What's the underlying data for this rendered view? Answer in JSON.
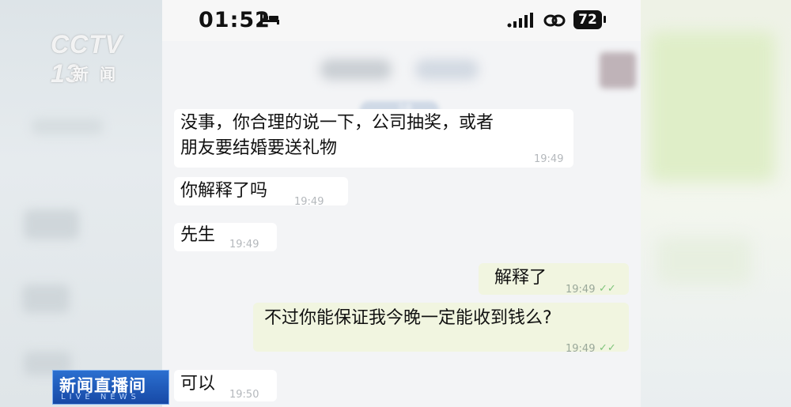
{
  "status_bar": {
    "time": "01:52",
    "battery": "72"
  },
  "overlay": {
    "channel_logo": "CCTV 13",
    "channel_sub": "新闻",
    "live_title": "新闻直播间",
    "live_sub": "LIVE NEWS"
  },
  "chat": {
    "date_chip": "18",
    "messages": [
      {
        "direction": "incoming",
        "lines": [
          "没事，你合理的说一下，公司抽奖，或者",
          "朋友要结婚要送礼物"
        ],
        "time": "19:49"
      },
      {
        "direction": "incoming",
        "lines": [
          "你解释了吗"
        ],
        "time": "19:49"
      },
      {
        "direction": "incoming",
        "lines": [
          "先生"
        ],
        "time": "19:49"
      },
      {
        "direction": "outgoing",
        "lines": [
          "解释了"
        ],
        "time": "19:49"
      },
      {
        "direction": "outgoing",
        "lines": [
          "不过你能保证我今晚一定能收到钱么?"
        ],
        "time": "19:49"
      },
      {
        "direction": "incoming",
        "lines": [
          "可以"
        ],
        "time": "19:50"
      }
    ]
  },
  "colors": {
    "incoming_bubble": "#ffffff",
    "outgoing_bubble": "#f1f5e0",
    "read_check": "#7ec47a",
    "live_badge": "#1f5bbf"
  },
  "icons": [
    "bed-icon",
    "signal-icon",
    "link-icon",
    "battery-icon",
    "read-check-icon"
  ]
}
